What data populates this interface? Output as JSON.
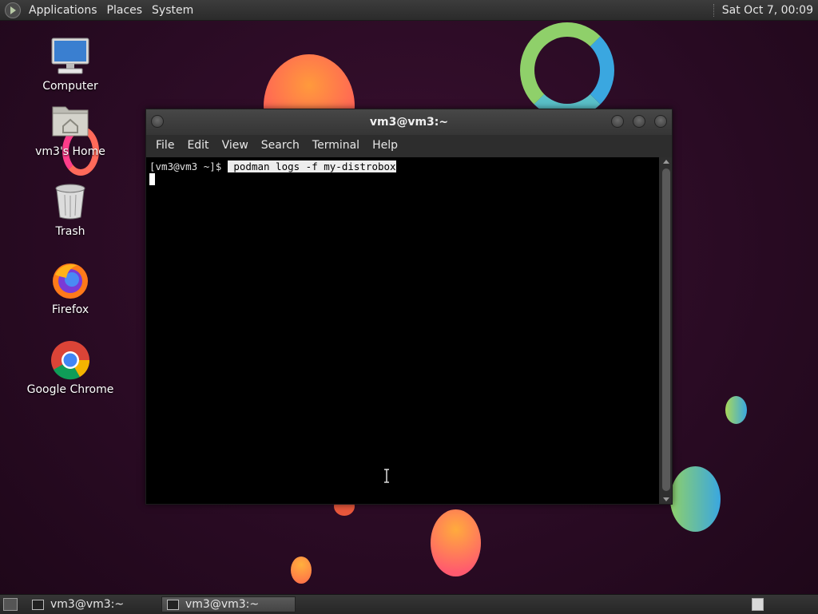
{
  "top_panel": {
    "menus": [
      "Applications",
      "Places",
      "System"
    ],
    "clock": "Sat Oct 7, 00:09"
  },
  "desktop_icons": [
    {
      "label": "Computer",
      "icon": "computer-icon"
    },
    {
      "label": "vm3's Home",
      "icon": "home-folder-icon"
    },
    {
      "label": "Trash",
      "icon": "trash-icon"
    },
    {
      "label": "Firefox",
      "icon": "firefox-icon"
    },
    {
      "label": "Google Chrome",
      "icon": "chrome-icon"
    }
  ],
  "terminal": {
    "title": "vm3@vm3:~",
    "menu": [
      "File",
      "Edit",
      "View",
      "Search",
      "Terminal",
      "Help"
    ],
    "prompt": "[vm3@vm3 ~]$ ",
    "command": " podman logs -f my-distrobox"
  },
  "taskbar": {
    "tasks": [
      {
        "label": "vm3@vm3:~",
        "active": false
      },
      {
        "label": "vm3@vm3:~",
        "active": true
      }
    ]
  }
}
